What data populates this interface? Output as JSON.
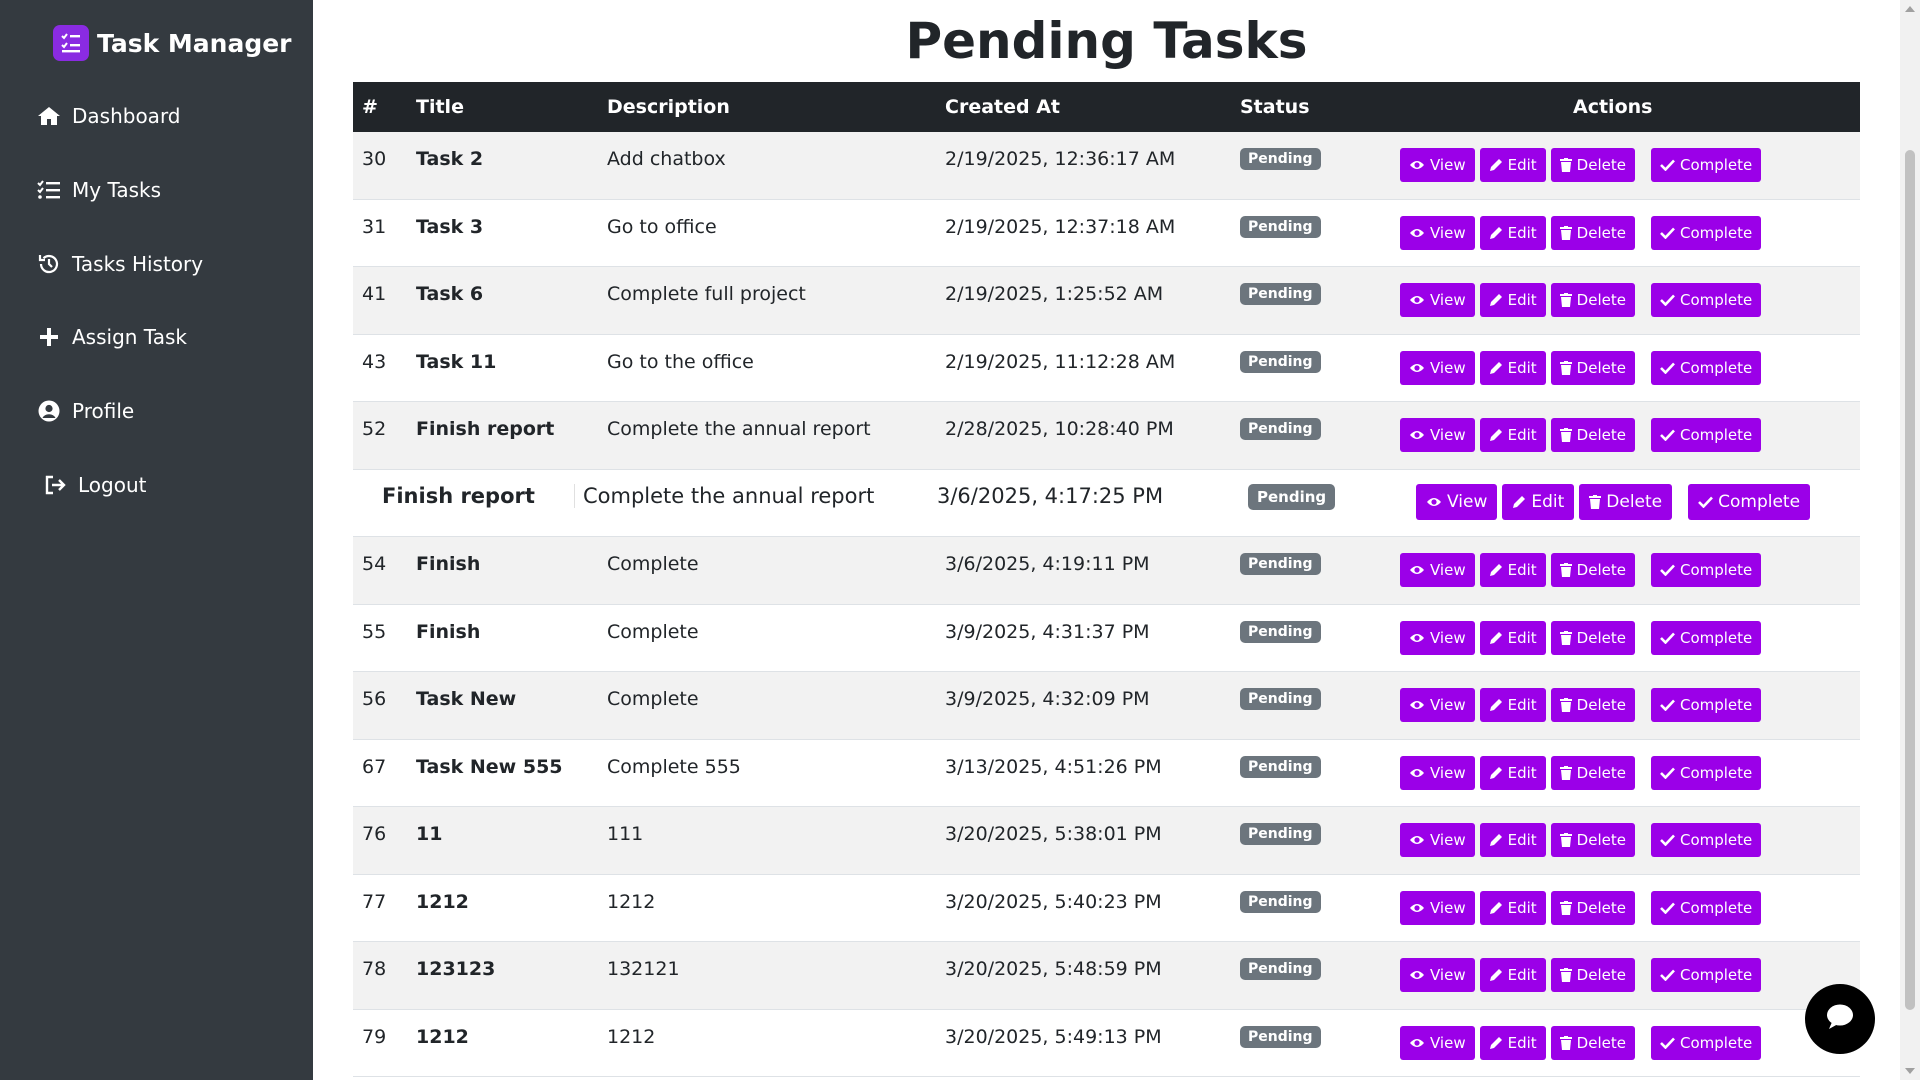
{
  "app": {
    "title": "Task Manager"
  },
  "sidebar": {
    "items": [
      {
        "label": "Dashboard",
        "icon": "home-icon"
      },
      {
        "label": "My Tasks",
        "icon": "list-icon"
      },
      {
        "label": "Tasks History",
        "icon": "history-icon"
      },
      {
        "label": "Assign Task",
        "icon": "plus-icon"
      },
      {
        "label": "Profile",
        "icon": "user-circle-icon"
      },
      {
        "label": "Logout",
        "icon": "logout-icon"
      }
    ]
  },
  "main": {
    "title": "Pending Tasks"
  },
  "table": {
    "headers": {
      "num": "#",
      "title": "Title",
      "description": "Description",
      "created": "Created At",
      "status": "Status",
      "actions": "Actions"
    },
    "actions": {
      "view": "View",
      "edit": "Edit",
      "delete": "Delete",
      "complete": "Complete"
    },
    "rows": [
      {
        "id": "30",
        "title": "Task 2",
        "description": "Add chatbox",
        "created": "2/19/2025, 12:36:17 AM",
        "status": "Pending"
      },
      {
        "id": "31",
        "title": "Task 3",
        "description": "Go to office",
        "created": "2/19/2025, 12:37:18 AM",
        "status": "Pending"
      },
      {
        "id": "41",
        "title": "Task 6",
        "description": "Complete full project",
        "created": "2/19/2025, 1:25:52 AM",
        "status": "Pending"
      },
      {
        "id": "43",
        "title": "Task 11",
        "description": "Go to the office",
        "created": "2/19/2025, 11:12:28 AM",
        "status": "Pending"
      },
      {
        "id": "52",
        "title": "Finish report",
        "description": "Complete the annual report",
        "created": "2/28/2025, 10:28:40 PM",
        "status": "Pending"
      },
      {
        "id": "",
        "title": "Finish report",
        "description": "Complete the annual report",
        "created": "3/6/2025, 4:17:25 PM",
        "status": "Pending"
      },
      {
        "id": "54",
        "title": "Finish",
        "description": "Complete",
        "created": "3/6/2025, 4:19:11 PM",
        "status": "Pending"
      },
      {
        "id": "55",
        "title": "Finish",
        "description": "Complete",
        "created": "3/9/2025, 4:31:37 PM",
        "status": "Pending"
      },
      {
        "id": "56",
        "title": "Task New",
        "description": "Complete",
        "created": "3/9/2025, 4:32:09 PM",
        "status": "Pending"
      },
      {
        "id": "67",
        "title": "Task New 555",
        "description": "Complete 555",
        "created": "3/13/2025, 4:51:26 PM",
        "status": "Pending"
      },
      {
        "id": "76",
        "title": "11",
        "description": "111",
        "created": "3/20/2025, 5:38:01 PM",
        "status": "Pending"
      },
      {
        "id": "77",
        "title": "1212",
        "description": "1212",
        "created": "3/20/2025, 5:40:23 PM",
        "status": "Pending"
      },
      {
        "id": "78",
        "title": "123123",
        "description": "132121",
        "created": "3/20/2025, 5:48:59 PM",
        "status": "Pending"
      },
      {
        "id": "79",
        "title": "1212",
        "description": "1212",
        "created": "3/20/2025, 5:49:13 PM",
        "status": "Pending"
      }
    ]
  },
  "colors": {
    "sidebar": "#343a40",
    "accent": "#9b00e8",
    "badge": "#6c757d",
    "header": "#212529"
  }
}
